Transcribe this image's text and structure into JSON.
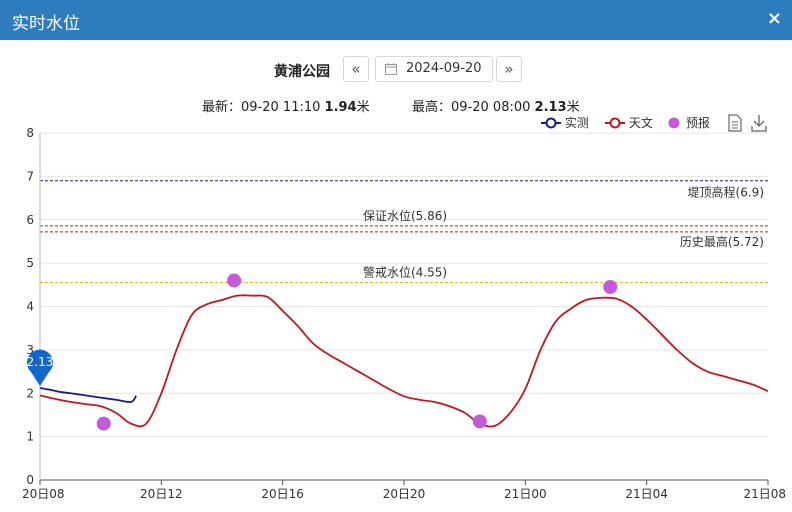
{
  "window": {
    "title": "实时水位",
    "close_glyph": "×"
  },
  "toolbar": {
    "station": "黄浦公园",
    "prev_glyph": "«",
    "next_glyph": "»",
    "date": "2024-09-20"
  },
  "stats": {
    "latest_label": "最新：",
    "latest_time": "09-20 11:10",
    "latest_value": "1.94",
    "latest_unit": "米",
    "max_label": "最高：",
    "max_time": "09-20 08:00",
    "max_value": "2.13",
    "max_unit": "米"
  },
  "legend": {
    "measured": "实测",
    "astronomical": "天文",
    "forecast": "预报",
    "icons": [
      "document-icon",
      "download-icon"
    ]
  },
  "colors": {
    "title_bar": "#2e7bbd",
    "measured": "#1a1a8c",
    "astronomical": "#c0181e",
    "forecast": "#c55ad8",
    "warning_line": "#e0b000"
  },
  "chart_data": {
    "type": "line",
    "x_unit": "hours since 20日08",
    "xlim": [
      0,
      24
    ],
    "ylim": [
      0,
      8
    ],
    "yticks": [
      0,
      1,
      2,
      3,
      4,
      5,
      6,
      7,
      8
    ],
    "xticks": [
      {
        "x": 0,
        "label": "20日08"
      },
      {
        "x": 4,
        "label": "20日12"
      },
      {
        "x": 8,
        "label": "20日16"
      },
      {
        "x": 12,
        "label": "20日20"
      },
      {
        "x": 16,
        "label": "21日00"
      },
      {
        "x": 20,
        "label": "21日04"
      },
      {
        "x": 24,
        "label": "21日08"
      }
    ],
    "reference_lines": [
      {
        "value": 6.9,
        "label": "堤顶高程(6.9)",
        "color": "#1a1a8c"
      },
      {
        "value": 5.86,
        "label": "保证水位(5.86)",
        "color": "#c0181e"
      },
      {
        "value": 5.72,
        "label": "历史最高(5.72)",
        "color": "#c0181e"
      },
      {
        "value": 4.55,
        "label": "警戒水位(4.55)",
        "color": "#e0b000"
      }
    ],
    "series": [
      {
        "name": "实测",
        "x": [
          0,
          0.33,
          0.67,
          1.0,
          1.5,
          2.0,
          2.5,
          3.0,
          3.17
        ],
        "values": [
          2.12,
          2.08,
          2.03,
          2.0,
          1.95,
          1.9,
          1.85,
          1.8,
          1.94
        ]
      },
      {
        "name": "天文",
        "x": [
          0,
          0.5,
          1,
          1.5,
          2,
          2.5,
          3,
          3.5,
          4,
          4.5,
          5,
          5.5,
          6,
          6.5,
          7,
          7.5,
          8,
          8.5,
          9,
          9.5,
          10,
          10.5,
          11,
          11.5,
          12,
          12.5,
          13,
          13.5,
          14,
          14.5,
          15,
          15.5,
          16,
          16.5,
          17,
          17.5,
          18,
          18.5,
          19,
          19.5,
          20,
          20.5,
          21,
          21.5,
          22,
          22.5,
          23,
          23.5,
          24
        ],
        "values": [
          1.95,
          1.87,
          1.8,
          1.75,
          1.7,
          1.55,
          1.3,
          1.3,
          2.0,
          3.0,
          3.8,
          4.05,
          4.15,
          4.25,
          4.25,
          4.22,
          3.9,
          3.55,
          3.15,
          2.9,
          2.7,
          2.5,
          2.3,
          2.1,
          1.93,
          1.85,
          1.8,
          1.7,
          1.55,
          1.3,
          1.25,
          1.55,
          2.1,
          3.0,
          3.65,
          3.95,
          4.15,
          4.2,
          4.18,
          4.0,
          3.7,
          3.35,
          3.0,
          2.7,
          2.5,
          2.4,
          2.3,
          2.2,
          2.05
        ]
      },
      {
        "name": "预报",
        "x": [
          2.1,
          6.4,
          14.5,
          18.8
        ],
        "values": [
          1.3,
          4.6,
          1.35,
          4.45
        ]
      }
    ],
    "marker": {
      "series": "实测",
      "x": 0,
      "value": "2.13"
    }
  }
}
